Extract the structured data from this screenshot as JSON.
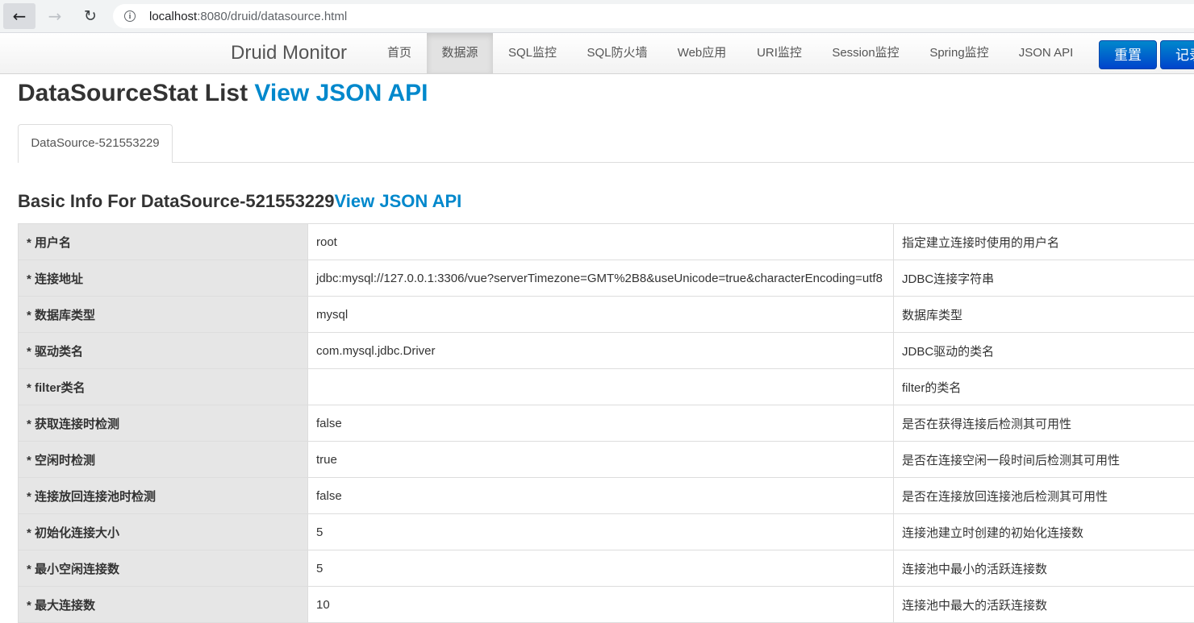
{
  "browser": {
    "url_host": "localhost",
    "url_path": ":8080/druid/datasource.html",
    "back_glyph": "←",
    "forward_glyph": "→",
    "reload_glyph": "↻",
    "info_glyph": "i"
  },
  "navbar": {
    "brand": "Druid Monitor",
    "items": [
      {
        "label": "首页"
      },
      {
        "label": "数据源"
      },
      {
        "label": "SQL监控"
      },
      {
        "label": "SQL防火墙"
      },
      {
        "label": "Web应用"
      },
      {
        "label": "URI监控"
      },
      {
        "label": "Session监控"
      },
      {
        "label": "Spring监控"
      },
      {
        "label": "JSON API"
      }
    ],
    "reset_label": "重置",
    "record_label": "记录"
  },
  "page": {
    "title": "DataSourceStat List ",
    "title_link": "View JSON API",
    "tab_label": "DataSource-521553229",
    "section_title": "Basic Info For DataSource-521553229",
    "section_link": "View JSON API"
  },
  "rows": [
    {
      "key": "* 用户名",
      "value": "root",
      "desc": "指定建立连接时使用的用户名"
    },
    {
      "key": "* 连接地址",
      "value": "jdbc:mysql://127.0.0.1:3306/vue?serverTimezone=GMT%2B8&useUnicode=true&characterEncoding=utf8",
      "desc": "JDBC连接字符串"
    },
    {
      "key": "* 数据库类型",
      "value": "mysql",
      "desc": "数据库类型"
    },
    {
      "key": "* 驱动类名",
      "value": "com.mysql.jdbc.Driver",
      "desc": "JDBC驱动的类名"
    },
    {
      "key": "* filter类名",
      "value": "",
      "desc": "filter的类名"
    },
    {
      "key": "* 获取连接时检测",
      "value": "false",
      "desc": "是否在获得连接后检测其可用性"
    },
    {
      "key": "* 空闲时检测",
      "value": "true",
      "desc": "是否在连接空闲一段时间后检测其可用性"
    },
    {
      "key": "* 连接放回连接池时检测",
      "value": "false",
      "desc": "是否在连接放回连接池后检测其可用性"
    },
    {
      "key": "* 初始化连接大小",
      "value": "5",
      "desc": "连接池建立时创建的初始化连接数"
    },
    {
      "key": "* 最小空闲连接数",
      "value": "5",
      "desc": "连接池中最小的活跃连接数"
    },
    {
      "key": "* 最大连接数",
      "value": "10",
      "desc": "连接池中最大的活跃连接数"
    }
  ],
  "colors": {
    "link": "#0088cc",
    "primary_button": "#0055cc",
    "key_cell_bg": "#e6e6e6"
  }
}
